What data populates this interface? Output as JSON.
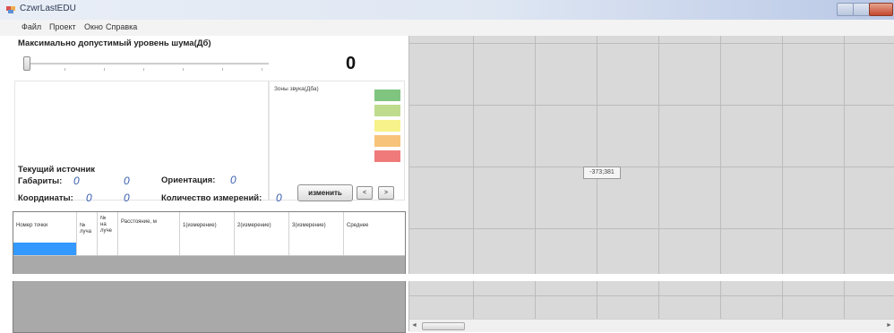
{
  "window": {
    "title": "CzwrLastEDU",
    "controls": {
      "minimize": "–",
      "maximize": "□",
      "close": "×"
    }
  },
  "menu": [
    {
      "label": "Файл"
    },
    {
      "label": "Проект"
    },
    {
      "label": "Окно"
    },
    {
      "label": "Справка"
    }
  ],
  "noise": {
    "label": "Максимально допустимый уровень шума(Дб)",
    "value": "0",
    "slider_level": 0
  },
  "zones": {
    "title": "Зоны звука(Дба)",
    "colors": [
      "#7fc47f",
      "#bfdc8e",
      "#f7f28a",
      "#f7c37a",
      "#f07a7a"
    ]
  },
  "source": {
    "heading": "Текущий источник",
    "dims_label": "Габариты:",
    "dims_v1": "0",
    "dims_v2": "0",
    "orient_label": "Ориентация:",
    "orient_v": "0",
    "coord_label": "Координаты:",
    "coord_v1": "0",
    "coord_v2": "0",
    "count_label": "Количество измерений:",
    "count_v": "0",
    "change_btn": "изменить",
    "prev_btn": "<",
    "next_btn": ">"
  },
  "table": {
    "columns": [
      "Номер точки",
      "№ луча",
      "№ на луче",
      "Расстояние, м",
      "1(измерение)",
      "2(измерение)",
      "3(измерение)",
      "Среднее"
    ]
  },
  "map": {
    "tooltip": "-373;381",
    "scroll_left": "◄",
    "scroll_right": "►"
  }
}
